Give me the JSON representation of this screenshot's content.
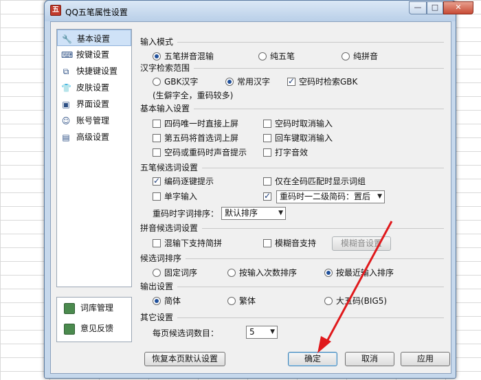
{
  "window": {
    "title": "QQ五笔属性设置",
    "icon_text": "五"
  },
  "sidebar": {
    "items": [
      {
        "label": "基本设置",
        "icon": "wrench-icon",
        "selected": true
      },
      {
        "label": "按键设置",
        "icon": "keyboard-icon"
      },
      {
        "label": "快捷键设置",
        "icon": "shortcut-icon"
      },
      {
        "label": "皮肤设置",
        "icon": "shirt-icon"
      },
      {
        "label": "界面设置",
        "icon": "window-icon"
      },
      {
        "label": "账号管理",
        "icon": "account-icon"
      },
      {
        "label": "高级设置",
        "icon": "advanced-icon"
      }
    ],
    "bottom_items": [
      {
        "label": "词库管理",
        "icon": "dictionary-icon"
      },
      {
        "label": "意见反馈",
        "icon": "feedback-icon"
      }
    ]
  },
  "sections": {
    "input_mode": {
      "title": "输入模式",
      "options": [
        "五笔拼音混输",
        "纯五笔",
        "纯拼音"
      ],
      "selected": "五笔拼音混输"
    },
    "charset": {
      "title": "汉字检索范围",
      "options": [
        "GBK汉字",
        "常用汉字"
      ],
      "selected": "常用汉字",
      "space_check_label": "空码时检索GBK",
      "space_check_checked": true,
      "note": "(生僻字全，重码较多)"
    },
    "basic": {
      "title": "基本输入设置",
      "checks": [
        {
          "label": "四码唯一时直接上屏",
          "checked": false
        },
        {
          "label": "空码时取消输入",
          "checked": false
        },
        {
          "label": "第五码将首选词上屏",
          "checked": false
        },
        {
          "label": "回车键取消输入",
          "checked": false
        },
        {
          "label": "空码或重码时声音提示",
          "checked": false
        },
        {
          "label": "打字音效",
          "checked": false
        }
      ]
    },
    "wubi": {
      "title": "五笔候选词设置",
      "checks": [
        {
          "label": "编码逐键提示",
          "checked": true
        },
        {
          "label": "仅在全码匹配时显示词组",
          "checked": false
        },
        {
          "label": "单字输入",
          "checked": false
        }
      ],
      "combo_check_checked": true,
      "combo_value": "重码时一二级简码：置后",
      "sort_label": "重码时字词排序：",
      "sort_value": "默认排序"
    },
    "pinyin": {
      "title": "拼音候选词设置",
      "checks": [
        {
          "label": "混输下支持简拼",
          "checked": false
        },
        {
          "label": "模糊音支持",
          "checked": false
        }
      ],
      "fuzzy_button": "模糊音设置"
    },
    "order": {
      "title": "候选词排序",
      "options": [
        "固定词序",
        "按输入次数排序",
        "按最近输入排序"
      ],
      "selected": "按最近输入排序"
    },
    "output": {
      "title": "输出设置",
      "options": [
        "简体",
        "繁体",
        "大五码(BIG5)"
      ],
      "selected": "简体"
    },
    "other": {
      "title": "其它设置",
      "count_label": "每页候选词数目：",
      "count_value": "5"
    }
  },
  "buttons": {
    "restore": "恢复本页默认设置",
    "ok": "确定",
    "cancel": "取消",
    "apply": "应用"
  },
  "colors": {
    "annotation_arrow": "#e0191c",
    "selection_bg": "#cfe2f7"
  }
}
